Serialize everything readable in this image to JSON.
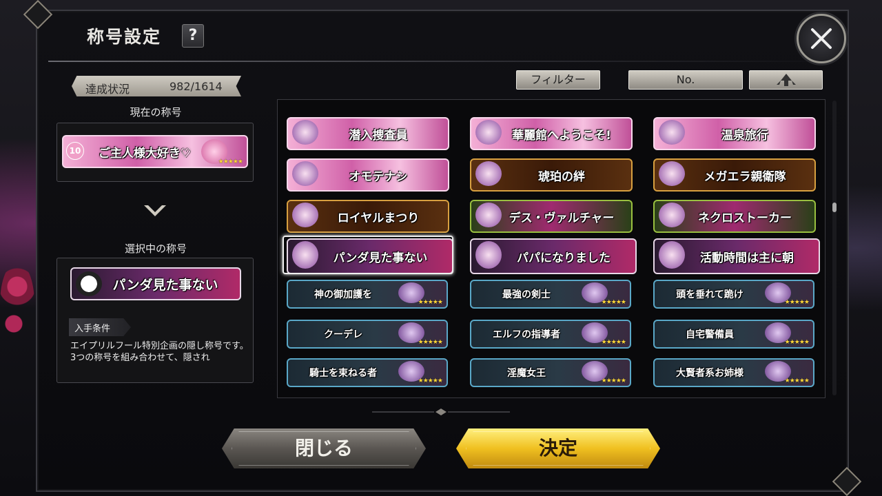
{
  "header": {
    "title": "称号設定",
    "help_label": "?"
  },
  "achievement": {
    "label": "達成状況",
    "value": "982/1614"
  },
  "current": {
    "section_label": "現在の称号",
    "title": {
      "text": "ご主人様大好き♡",
      "level": "10",
      "stars": "★★★★★"
    }
  },
  "selected": {
    "section_label": "選択中の称号",
    "title": {
      "text": "パンダ見た事ない"
    },
    "condition_label": "入手条件",
    "description": "エイプリルフール特別企画の隠し称号です。\n3つの称号を組み合わせて、隠され"
  },
  "toolbar": {
    "filter_label": "フィルター",
    "sort_label": "No.",
    "order_icon": "sort-order-icon"
  },
  "titles": [
    {
      "text": "潜入捜査員",
      "theme": "pink"
    },
    {
      "text": "華麗館へようこそ!",
      "theme": "pink"
    },
    {
      "text": "温泉旅行",
      "theme": "pink"
    },
    {
      "text": "オモテナシ",
      "theme": "pink"
    },
    {
      "text": "琥珀の絆",
      "theme": "gold"
    },
    {
      "text": "メガエラ親衛隊",
      "theme": "gold"
    },
    {
      "text": "ロイヤルまつり",
      "theme": "gold"
    },
    {
      "text": "デス・ヴァルチャー",
      "theme": "green"
    },
    {
      "text": "ネクロストーカー",
      "theme": "green"
    },
    {
      "text": "パンダ見た事ない",
      "theme": "panda"
    },
    {
      "text": "パパになりました",
      "theme": "panda"
    },
    {
      "text": "活動時間は主に朝",
      "theme": "panda"
    },
    {
      "text": "神の御加護を",
      "theme": "blue",
      "stars": "★★★★★"
    },
    {
      "text": "最強の剣士",
      "theme": "blue",
      "stars": "★★★★★"
    },
    {
      "text": "頭を垂れて跪け",
      "theme": "blue",
      "stars": "★★★★★"
    },
    {
      "text": "クーデレ",
      "theme": "blue",
      "stars": "★★★★★"
    },
    {
      "text": "エルフの指導者",
      "theme": "blue",
      "stars": "★★★★★"
    },
    {
      "text": "自宅警備員",
      "theme": "blue",
      "stars": "★★★★★"
    },
    {
      "text": "騎士を束ねる者",
      "theme": "blue",
      "stars": "★★★★★"
    },
    {
      "text": "淫魔女王",
      "theme": "blue",
      "stars": "★★★★★"
    },
    {
      "text": "大賢者系お姉様",
      "theme": "blue",
      "stars": "★★★★★"
    }
  ],
  "buttons": {
    "close_label": "閉じる",
    "ok_label": "決定"
  }
}
